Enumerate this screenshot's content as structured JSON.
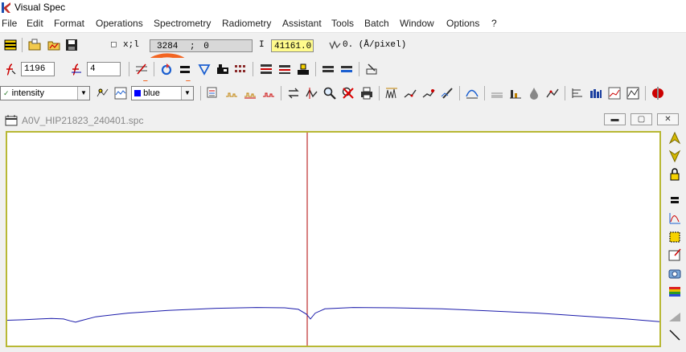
{
  "app": {
    "title": "Visual Spec"
  },
  "menu": [
    "File",
    "Edit",
    "Format",
    "Operations",
    "Spectrometry",
    "Radiometry",
    "Assistant",
    "Tools",
    "Batch",
    "Window",
    "Options",
    "?"
  ],
  "toolbar1": {
    "xi_label": "x;l",
    "x_value": "3284",
    "x_sep": ";",
    "l_value": "0",
    "i_label": "I",
    "intensity_value": "41161.0",
    "dispersion_label": "0. (Å/pixel)"
  },
  "toolbar2": {
    "field1": "1196",
    "field2": "4"
  },
  "toolbar3": {
    "profile_select": "intensity",
    "color_select": "blue",
    "color_swatch": "#0000ff"
  },
  "document": {
    "title": "A0V_HIP21823_240401.spc"
  },
  "chart_data": {
    "type": "line",
    "series": [
      {
        "color": "#1a1aaa",
        "points": [
          [
            0,
            0.95
          ],
          [
            20,
            0.97
          ],
          [
            40,
            1.0
          ],
          [
            55,
            1.02
          ],
          [
            70,
            1.0
          ],
          [
            78,
            0.93
          ],
          [
            85,
            0.88
          ],
          [
            92,
            0.94
          ],
          [
            110,
            1.08
          ],
          [
            150,
            1.22
          ],
          [
            200,
            1.32
          ],
          [
            260,
            1.4
          ],
          [
            310,
            1.43
          ],
          [
            345,
            1.42
          ],
          [
            362,
            1.36
          ],
          [
            372,
            1.18
          ],
          [
            377,
            1.0
          ],
          [
            383,
            1.22
          ],
          [
            395,
            1.38
          ],
          [
            430,
            1.43
          ],
          [
            480,
            1.42
          ],
          [
            540,
            1.38
          ],
          [
            600,
            1.3
          ],
          [
            660,
            1.22
          ],
          [
            720,
            1.1
          ],
          [
            770,
            1.0
          ],
          [
            811,
            0.9
          ]
        ]
      }
    ],
    "marker_x": 373,
    "ylim": [
      0,
      8
    ]
  },
  "colors": {
    "plot_border": "#b8b834",
    "marker": "#b00000",
    "annotation": "#f26522"
  }
}
